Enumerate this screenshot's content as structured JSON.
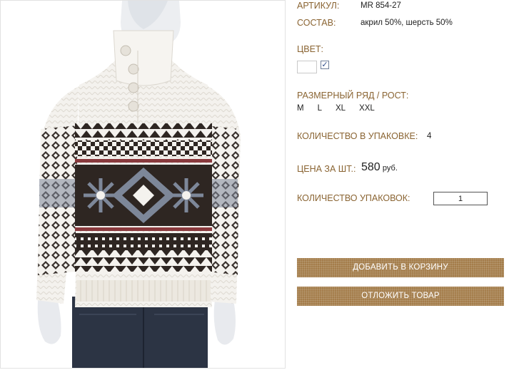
{
  "product": {
    "article_label": "АРТИКУЛ:",
    "article_value": "MR 854-27",
    "composition_label": "СОСТАВ:",
    "composition_value": "акрил 50%, шерсть 50%",
    "color_label": "ЦВЕТ:",
    "color_checked_mark": "✓",
    "size_label": "РАЗМЕРНЫЙ РЯД / РОСТ:",
    "sizes": [
      "M",
      "L",
      "XL",
      "XXL"
    ],
    "pack_qty_label": "КОЛИЧЕСТВО В УПАКОВКЕ:",
    "pack_qty_value": "4",
    "price_label": "ЦЕНА ЗА ШТ.:",
    "price_value": "580",
    "price_currency": "руб.",
    "packs_label": "КОЛИЧЕСТВО УПАКОВОК:",
    "packs_value": "1"
  },
  "actions": {
    "add_to_cart": "ДОБАВИТЬ В КОРЗИНУ",
    "save_for_later": "ОТЛОЖИТЬ ТОВАР"
  },
  "colors": {
    "label": "#8a6432",
    "button": "#a47d4b",
    "sweater_white": "#f4f2ee",
    "pattern_dark": "#2e2622",
    "pattern_gray": "#7d8799",
    "pattern_red": "#8a3a3e",
    "jeans": "#2c3444"
  }
}
